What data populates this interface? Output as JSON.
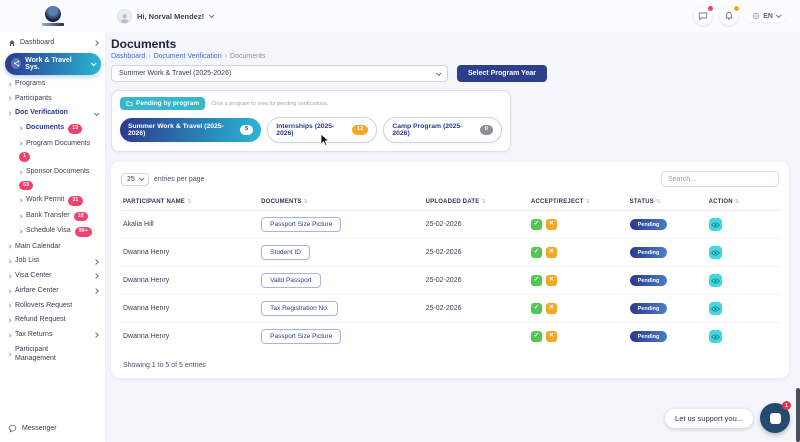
{
  "header": {
    "greeting": "Hi, Norval Mendez!",
    "language": "EN"
  },
  "sidebar": {
    "items": [
      {
        "label": "Dashboard"
      },
      {
        "label": "Work & Travel Sys."
      },
      {
        "label": "Programs"
      },
      {
        "label": "Participants"
      },
      {
        "label": "Doc Verification"
      },
      {
        "label": "Documents",
        "badge": "13"
      },
      {
        "label": "Program Documents",
        "badge": "1"
      },
      {
        "label": "Sponsor Documents",
        "badge": "63"
      },
      {
        "label": "Work Permit",
        "badge": "31"
      },
      {
        "label": "Bank Transfer",
        "badge": "18"
      },
      {
        "label": "Schedule Visa",
        "badge": "99+"
      },
      {
        "label": "Main Calendar"
      },
      {
        "label": "Job List"
      },
      {
        "label": "Visa Center"
      },
      {
        "label": "Airfare Center"
      },
      {
        "label": "Rollovers Request"
      },
      {
        "label": "Refund Request"
      },
      {
        "label": "Tax Returns"
      },
      {
        "label": "Participant Management"
      },
      {
        "label": "Messenger"
      }
    ]
  },
  "page": {
    "title": "Documents",
    "breadcrumb": [
      "Dashboard",
      "Document Verification",
      "Documents"
    ],
    "crumb_separator": "›",
    "program_select_value": "Summer Work & Travel (2025-2026)",
    "select_button": "Select Program Year"
  },
  "pending": {
    "chip": "Pending by program",
    "hint": "Click a program to view its pending verifications.",
    "tabs": [
      {
        "label": "Summer Work & Travel (2025-2026)",
        "count": "5"
      },
      {
        "label": "Internships (2025-2026)",
        "count": "12"
      },
      {
        "label": "Camp Program (2025-2026)",
        "count": "0"
      }
    ]
  },
  "table": {
    "page_size": "25",
    "page_size_label": "entries per page",
    "search_placeholder": "Search...",
    "columns": [
      "PARTICIPANT NAME",
      "DOCUMENTS",
      "UPLOADED DATE",
      "ACCEPT/REJECT",
      "STATUS",
      "ACTION"
    ],
    "rows": [
      {
        "name": "Akalia Hill",
        "document": "Passport Size Picture",
        "date": "25-02-2026",
        "status": "Pending"
      },
      {
        "name": "Dwanna Henry",
        "document": "Student ID",
        "date": "25-02-2026",
        "status": "Pending"
      },
      {
        "name": "Dwanna Henry",
        "document": "Valid Passport",
        "date": "25-02-2026",
        "status": "Pending"
      },
      {
        "name": "Dwanna Henry",
        "document": "Tax Registration No.",
        "date": "25-02-2026",
        "status": "Pending"
      },
      {
        "name": "Dwanna Henry",
        "document": "Passport Size Picture",
        "date": "",
        "status": "Pending"
      }
    ],
    "summary": "Showing 1 to 5 of 5 entries"
  },
  "support": {
    "bubble": "Let us support you...",
    "badge": "1"
  },
  "icons": {
    "check": "✓",
    "cross": "✕",
    "sort": "⇅"
  },
  "colors": {
    "navy": "#2b3990",
    "teal": "#2ab6d4",
    "chip_teal": "#35b8c9",
    "green": "#53c654",
    "orange": "#f5a623",
    "pink_badge": "#f1416c",
    "button_navy": "#2d3e8f",
    "support_navy": "#254a72"
  }
}
